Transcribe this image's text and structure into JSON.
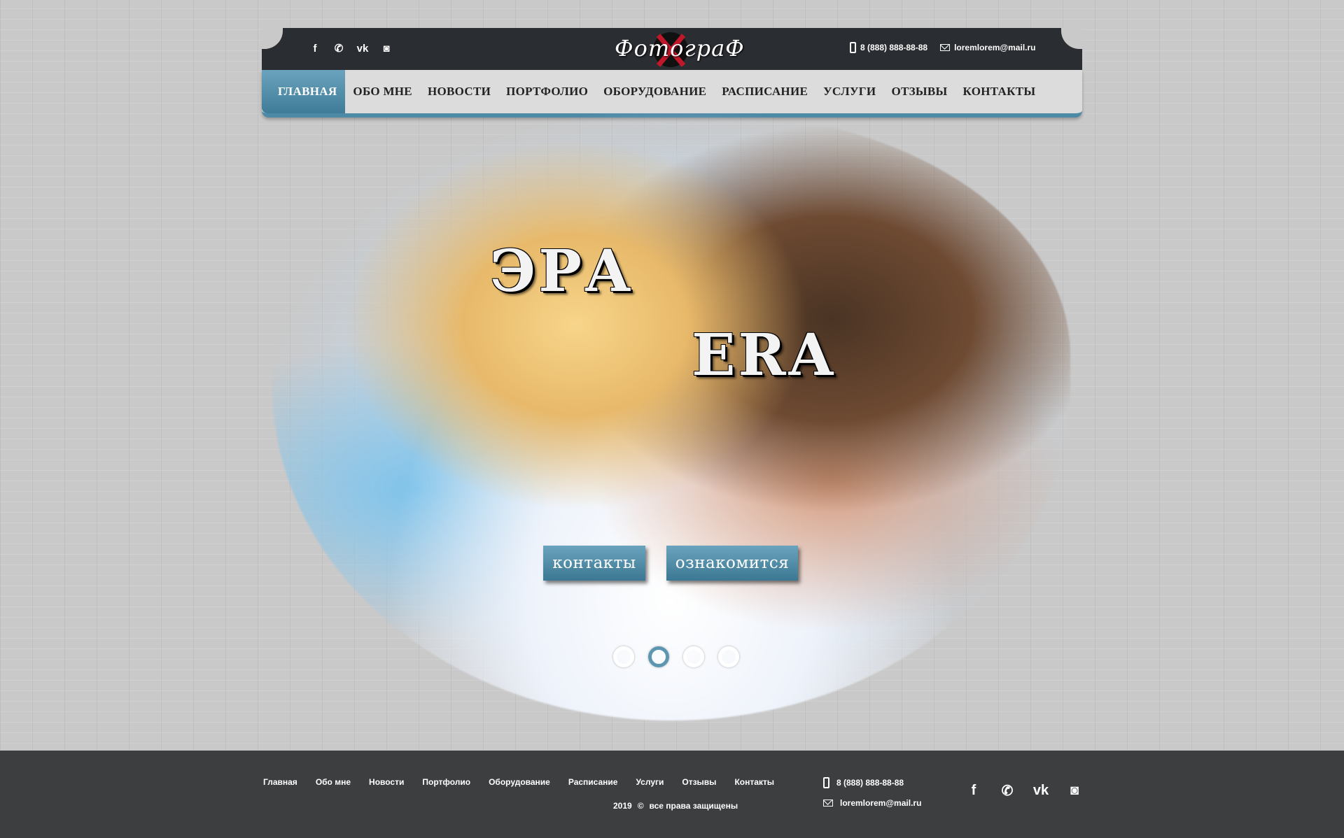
{
  "header": {
    "logo_text": "ФотограФ",
    "phone": "8 (888) 888-88-88",
    "email": "loremlorem@mail.ru",
    "social": [
      {
        "name": "facebook-icon",
        "glyph": "f"
      },
      {
        "name": "whatsapp-icon",
        "glyph": "✆"
      },
      {
        "name": "vk-icon",
        "glyph": "vk"
      },
      {
        "name": "instagram-icon",
        "glyph": "◙"
      }
    ]
  },
  "nav": {
    "items": [
      "ГЛАВНАЯ",
      "ОБО МНЕ",
      "НОВОСТИ",
      "ПОРТФОЛИО",
      "ОБОРУДОВАНИЕ",
      "РАСПИСАНИЕ",
      "УСЛУГИ",
      "ОТЗЫВЫ",
      "КОНТАКТЫ"
    ],
    "active_index": 0
  },
  "hero": {
    "title_ru": "ЭРА",
    "title_en": "ERA",
    "button_contacts": "контакты",
    "button_about": "ознакомится",
    "slides_count": 4,
    "active_slide": 2
  },
  "footer": {
    "nav": [
      "Главная",
      "Обо мне",
      "Новости",
      "Портфолио",
      "Оборудование",
      "Расписание",
      "Услуги",
      "Отзывы",
      "Контакты"
    ],
    "copyright_year": "2019",
    "copyright_symbol": "©",
    "copyright_text": "все права защищены",
    "phone": "8 (888) 888-88-88",
    "email": "loremlorem@mail.ru"
  },
  "colors": {
    "accent": "#4d8aa6",
    "topbar": "#2a2d31",
    "navbar": "#dcdcdc",
    "footer": "#3d3e40"
  }
}
